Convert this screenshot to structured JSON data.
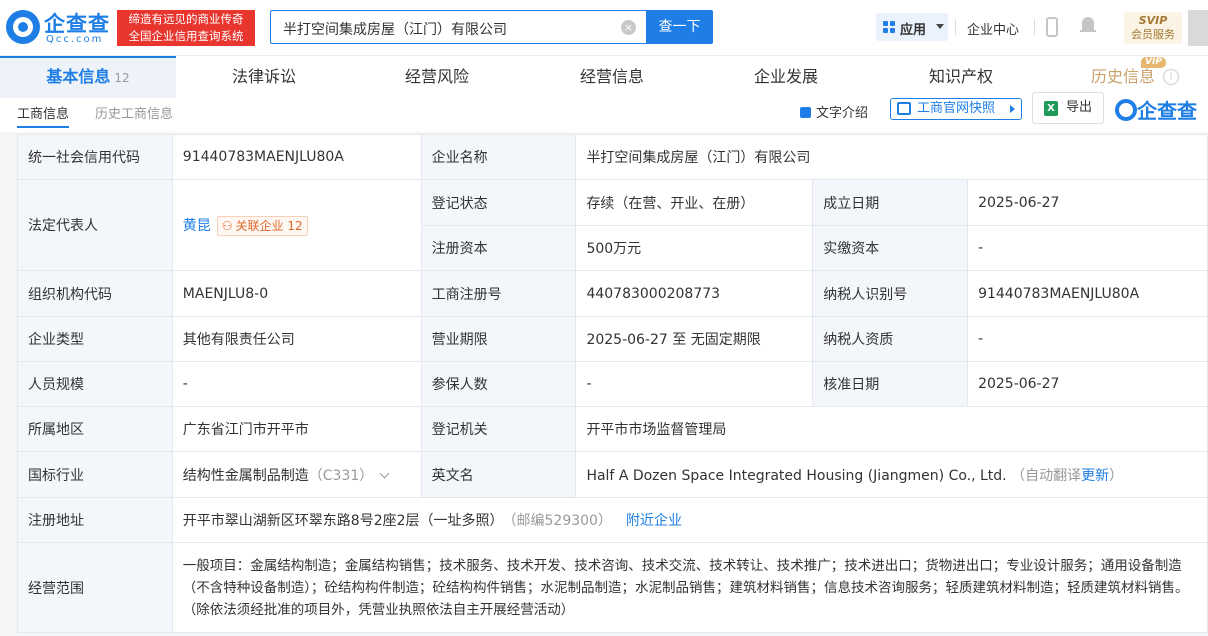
{
  "brand": {
    "name": "企查查",
    "url": "Qcc.com",
    "slogan_line1": "缔造有远见的商业传奇",
    "slogan_line2": "全国企业信用查询系统"
  },
  "search": {
    "value": "半打空间集成房屋（江门）有限公司",
    "clear_icon": "×",
    "button": "查一下"
  },
  "header": {
    "apps": "应用",
    "enterprise_center": "企业中心",
    "svip_line1": "SVIP",
    "svip_line2": "会员服务"
  },
  "tabs": [
    {
      "label": "基本信息",
      "count": "12"
    },
    {
      "label": "法律诉讼"
    },
    {
      "label": "经营风险"
    },
    {
      "label": "经营信息"
    },
    {
      "label": "企业发展"
    },
    {
      "label": "知识产权"
    },
    {
      "label": "历史信息",
      "badge": "VIP"
    }
  ],
  "info_icon": "i",
  "subtabs": [
    "工商信息",
    "历史工商信息"
  ],
  "tools": {
    "intro": "文字介绍",
    "snapshot": "工商官网快照",
    "export": "导出",
    "export_icon": "X",
    "watermark": "企查查"
  },
  "table": {
    "credit_code_label": "统一社会信用代码",
    "credit_code": "91440783MAENJLU80A",
    "company_name_label": "企业名称",
    "company_name": "半打空间集成房屋（江门）有限公司",
    "legal_rep_label": "法定代表人",
    "legal_rep": "黄昆",
    "related_label": "关联企业",
    "related_count": "12",
    "reg_status_label": "登记状态",
    "reg_status": "存续（在营、开业、在册）",
    "founded_label": "成立日期",
    "founded": "2025-06-27",
    "reg_capital_label": "注册资本",
    "reg_capital": "500万元",
    "paid_capital_label": "实缴资本",
    "paid_capital": "-",
    "org_code_label": "组织机构代码",
    "org_code": "MAENJLU8-0",
    "biz_reg_no_label": "工商注册号",
    "biz_reg_no": "440783000208773",
    "taxpayer_id_label": "纳税人识别号",
    "taxpayer_id": "91440783MAENJLU80A",
    "type_label": "企业类型",
    "type": "其他有限责任公司",
    "term_label": "营业期限",
    "term": "2025-06-27 至 无固定期限",
    "taxpayer_qual_label": "纳税人资质",
    "taxpayer_qual": "-",
    "staff_label": "人员规模",
    "staff": "-",
    "insured_label": "参保人数",
    "insured": "-",
    "approved_label": "核准日期",
    "approved": "2025-06-27",
    "region_label": "所属地区",
    "region": "广东省江门市开平市",
    "authority_label": "登记机关",
    "authority": "开平市市场监督管理局",
    "industry_label": "国标行业",
    "industry": "结构性金属制品制造",
    "industry_code": "（C331）",
    "english_label": "英文名",
    "english": "Half A Dozen Space Integrated Housing (Jiangmen) Co., Ltd.",
    "auto_translate": "（自动翻译",
    "update": "更新",
    "close_paren": "）",
    "address_label": "注册地址",
    "address": "开平市翠山湖新区环翠东路8号2座2层（一址多照）",
    "postcode": "（邮编529300）",
    "nearby": "附近企业",
    "scope_label": "经营范围",
    "scope": "一般项目：金属结构制造；金属结构销售；技术服务、技术开发、技术咨询、技术交流、技术转让、技术推广；技术进出口；货物进出口；专业设计服务；通用设备制造（不含特种设备制造）；砼结构构件制造；砼结构构件销售；水泥制品制造；水泥制品销售；建筑材料销售；信息技术咨询服务；轻质建筑材料制造；轻质建筑材料销售。（除依法须经批准的项目外，凭营业执照依法自主开展经营活动）"
  },
  "colors": {
    "accent": "#1e7ee6",
    "slogan_bg": "#e8362e",
    "label_bg": "#f3f6fa",
    "vip": "#c9a06a"
  }
}
